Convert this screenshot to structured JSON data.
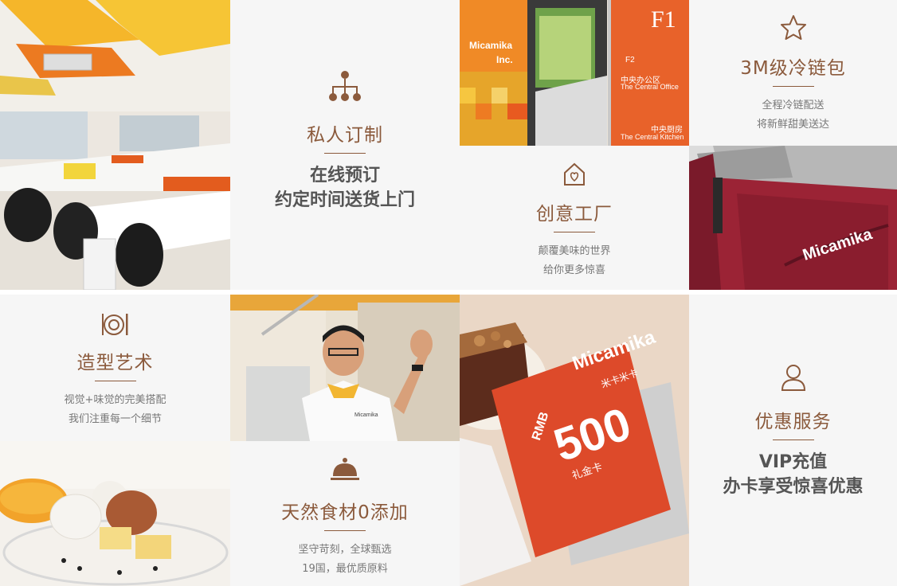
{
  "colors": {
    "accent": "#8b5a3c",
    "panel_bg": "#f6f6f6",
    "orange": "#e8602a",
    "card_red": "#d8432a"
  },
  "private_custom": {
    "icon": "org-chart-icon",
    "title": "私人订制",
    "lines": [
      "在线预订",
      "约定时间送货上门"
    ]
  },
  "cold_chain": {
    "icon": "star-icon",
    "title": "3M级冷链包",
    "lines": [
      "全程冷链配送",
      "将新鲜甜美送达"
    ]
  },
  "creative_factory": {
    "icon": "house-heart-icon",
    "title": "创意工厂",
    "lines": [
      "颠覆美味的世界",
      "给你更多惊喜"
    ]
  },
  "styling_art": {
    "icon": "plate-icon",
    "title": "造型艺术",
    "lines": [
      "视觉+味觉的完美搭配",
      "我们注重每一个细节"
    ]
  },
  "natural_ingredients": {
    "icon": "cloche-icon",
    "title": "天然食材0添加",
    "lines": [
      "坚守苛刻，全球甄选",
      "19国，最优质原料"
    ]
  },
  "discount_service": {
    "icon": "user-icon",
    "title": "优惠服务",
    "lines": [
      "VIP充值",
      "办卡享受惊喜优惠"
    ]
  },
  "signage": {
    "floor": "F1",
    "floor2": "F2",
    "office_cn": "中央办公区",
    "office_en": "The Central Office",
    "kitchen_cn": "中央厨房",
    "kitchen_en": "The Central Kitchen",
    "brand": "Micamika",
    "brand_inc": "Inc."
  },
  "bag": {
    "brand": "Micamika"
  },
  "gift_card": {
    "brand": "Micamika",
    "brand_cn": "米卡米卡",
    "currency": "RMB",
    "amount": "500",
    "label": "礼金卡"
  },
  "chef": {
    "brand": "Micamika"
  }
}
